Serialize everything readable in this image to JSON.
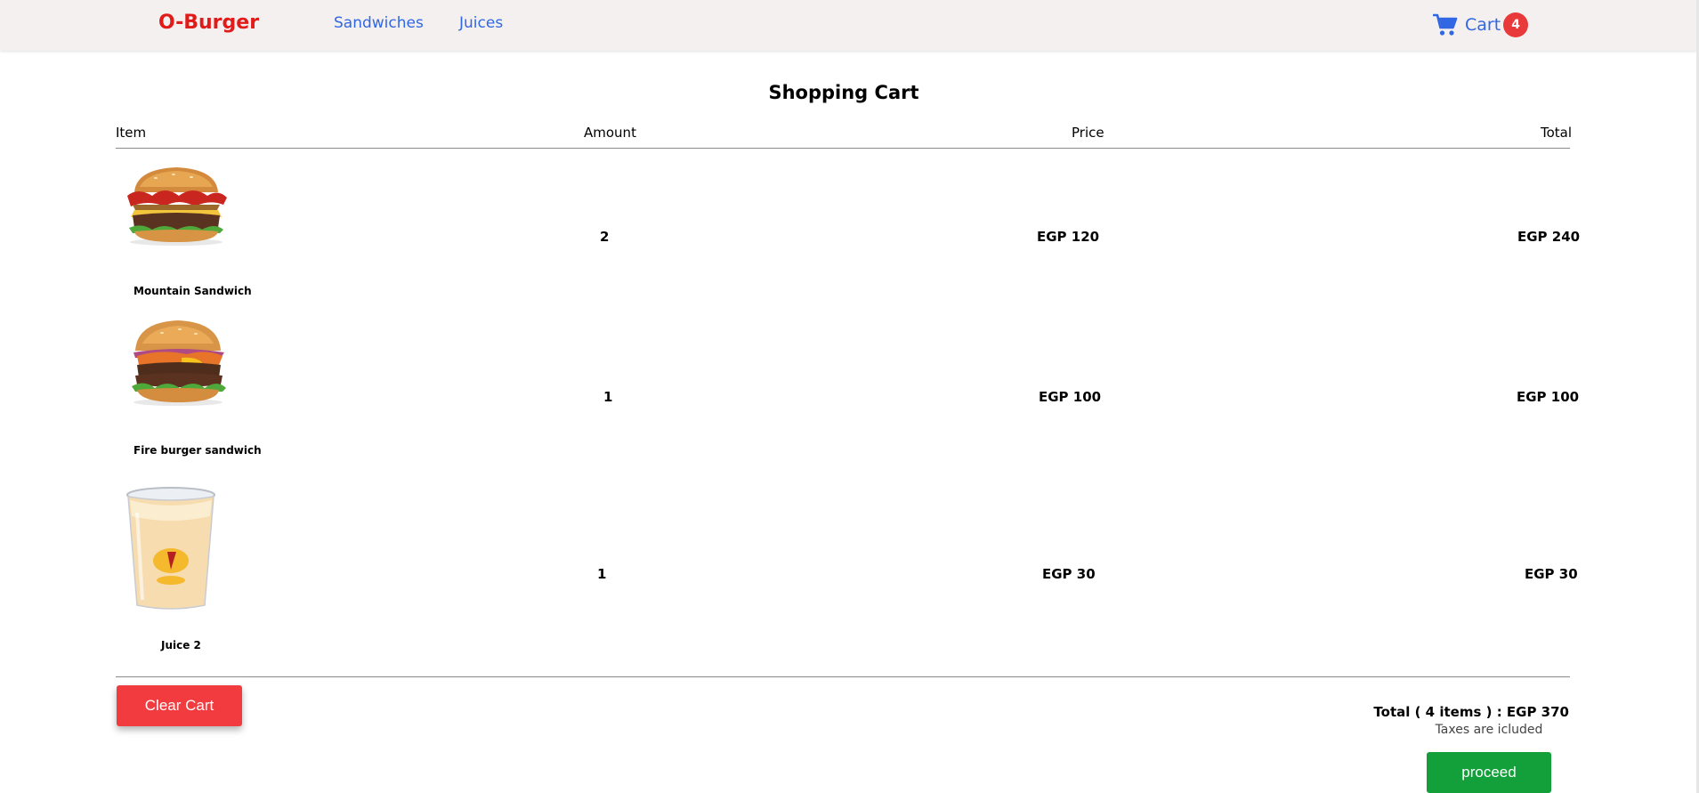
{
  "navbar": {
    "brand": "O-Burger",
    "links": [
      "Sandwiches",
      "Juices"
    ],
    "cart_label": "Cart",
    "cart_count": "4",
    "cart_icon": "shopping-cart-icon",
    "brand_color": "#e11a1a",
    "link_color": "#3167e3",
    "badge_color": "#e83a3a"
  },
  "cart": {
    "title": "Shopping Cart",
    "columns": [
      "Item",
      "Amount",
      "Price",
      "Total"
    ],
    "items": [
      {
        "name": "Mountain Sandwich",
        "amount": "2",
        "price": "EGP 120",
        "total": "EGP 240",
        "image": "burger-image"
      },
      {
        "name": "Fire burger sandwich",
        "amount": "1",
        "price": "EGP 100",
        "total": "EGP 100",
        "image": "burger-image"
      },
      {
        "name": "Juice 2",
        "amount": "1",
        "price": "EGP 30",
        "total": "EGP 30",
        "image": "juice-cup-image"
      }
    ]
  },
  "footer": {
    "clear_label": "Clear Cart",
    "total_summary": "Total ( 4 items ) : EGP 370",
    "tax_note": "Taxes are icluded",
    "proceed_label": "proceed",
    "clear_color": "#f13b3f",
    "proceed_color": "#13a03a"
  }
}
